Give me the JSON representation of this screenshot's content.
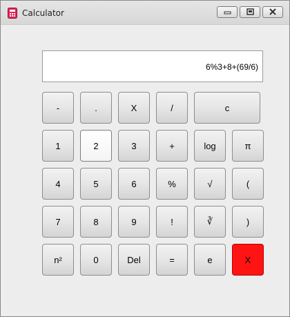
{
  "window": {
    "title": "Calculator",
    "controls": {
      "minimize": "minimize",
      "maximize": "maximize",
      "close": "close"
    }
  },
  "display": {
    "expression": "6%3+8+(69/6)"
  },
  "buttons": {
    "minus": "-",
    "dot": ".",
    "times": "X",
    "divide": "/",
    "clear": "c",
    "one": "1",
    "two": "2",
    "three": "3",
    "plus": "+",
    "log": "log",
    "pi": "π",
    "four": "4",
    "five": "5",
    "six": "6",
    "percent": "%",
    "sqrt": "√",
    "lparen": "(",
    "seven": "7",
    "eight": "8",
    "nine": "9",
    "factorial": "!",
    "cbrt": "∛",
    "rparen": ")",
    "square": "n²",
    "zero": "0",
    "del": "Del",
    "equals": "=",
    "e": "e",
    "exit": "X"
  },
  "colors": {
    "exit_button": "#ff1414",
    "window_bg": "#ededed"
  },
  "icons": {
    "app": "calculator-icon"
  }
}
